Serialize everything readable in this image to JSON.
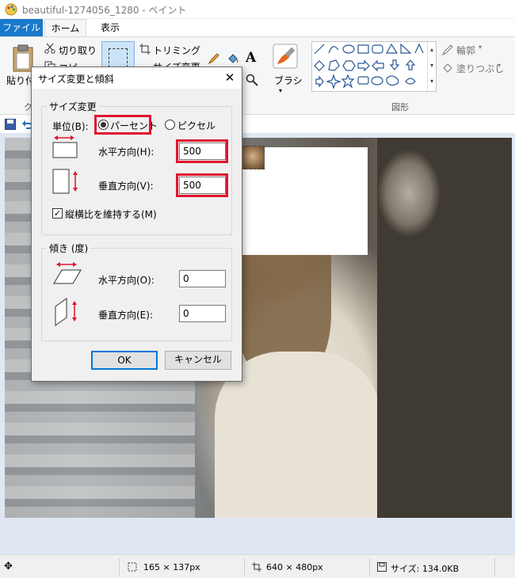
{
  "window": {
    "title": "beautiful-1274056_1280 - ペイント"
  },
  "tabs": [
    {
      "label": "ファイル"
    },
    {
      "label": "ホーム"
    },
    {
      "label": "表示"
    }
  ],
  "ribbon": {
    "paste": "貼り付",
    "cut": "切り取り",
    "copy": "コピ",
    "crop": "トリミング",
    "resize": "サイズ変更",
    "brushes": "ブラシ",
    "outline": "輪郭",
    "fill": "塗りつぶし",
    "shapes_group": "図形",
    "clipboard_group": "ク"
  },
  "dialog": {
    "title": "サイズ変更と傾斜",
    "resize_group": "サイズ変更",
    "unit_label": "単位(B):",
    "percent": "パーセント",
    "pixels": "ピクセル",
    "horizontal_label": "水平方向(H):",
    "horizontal_value": "500",
    "vertical_label": "垂直方向(V):",
    "vertical_value": "500",
    "keep_ratio": "縦横比を維持する(M)",
    "skew_group": "傾き (度)",
    "skew_h_label": "水平方向(O):",
    "skew_h_value": "0",
    "skew_v_label": "垂直方向(E):",
    "skew_v_value": "0",
    "ok": "OK",
    "cancel": "キャンセル"
  },
  "status": {
    "selection_size": "165 × 137px",
    "image_size": "640 × 480px",
    "file_size": "サイズ: 134.0KB"
  },
  "colors": {
    "accent": "#1979ca",
    "highlight": "#e0142e"
  }
}
